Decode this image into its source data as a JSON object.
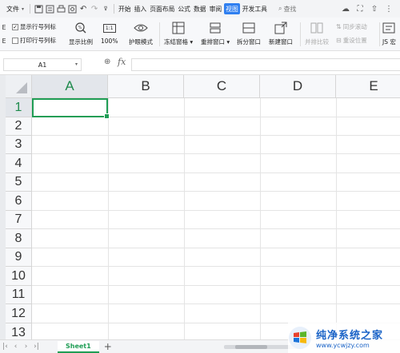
{
  "menubar": {
    "file_label": "文件",
    "tabs": [
      "开始",
      "插入",
      "页面布局",
      "公式",
      "数据",
      "审阅",
      "视图",
      "开发工具"
    ],
    "active_tab": "视图",
    "search_label": "查找"
  },
  "ribbon": {
    "edge_top": "E",
    "edge_bottom": "E",
    "show_row_col_label": "显示行号列标",
    "print_row_col_label": "打印行号列标",
    "show_row_col_checked": true,
    "print_row_col_checked": false,
    "buttons": {
      "zoom": "显示比例",
      "zoom100": "100%",
      "eye_protect": "护眼模式",
      "freeze": "冻结窗格",
      "rearrange": "重排窗口",
      "split": "拆分窗口",
      "new_window": "新建窗口",
      "side_by_side": "并排比较",
      "sync_scroll": "同步滚动",
      "reset_pos": "重设位置",
      "js": "JS 宏"
    },
    "zoom100_icon_text": "1:1"
  },
  "formula_bar": {
    "name_box": "A1",
    "fx_label": "fx",
    "value": ""
  },
  "grid": {
    "columns": [
      "A",
      "B",
      "C",
      "D",
      "E"
    ],
    "rows": [
      "1",
      "2",
      "3",
      "4",
      "5",
      "6",
      "7",
      "8",
      "9",
      "10",
      "11",
      "12",
      "13"
    ],
    "selected_cell": "A1",
    "accent": "#1f9d55"
  },
  "sheetbar": {
    "sheet_name": "Sheet1",
    "add_label": "+"
  },
  "watermark": {
    "title": "纯净系统之家",
    "url": "www.ycwjzy.com"
  },
  "colors": {
    "active_tab": "#2f7ff0",
    "selection_green": "#1f9d55",
    "header_bg": "#f7f8fa"
  }
}
